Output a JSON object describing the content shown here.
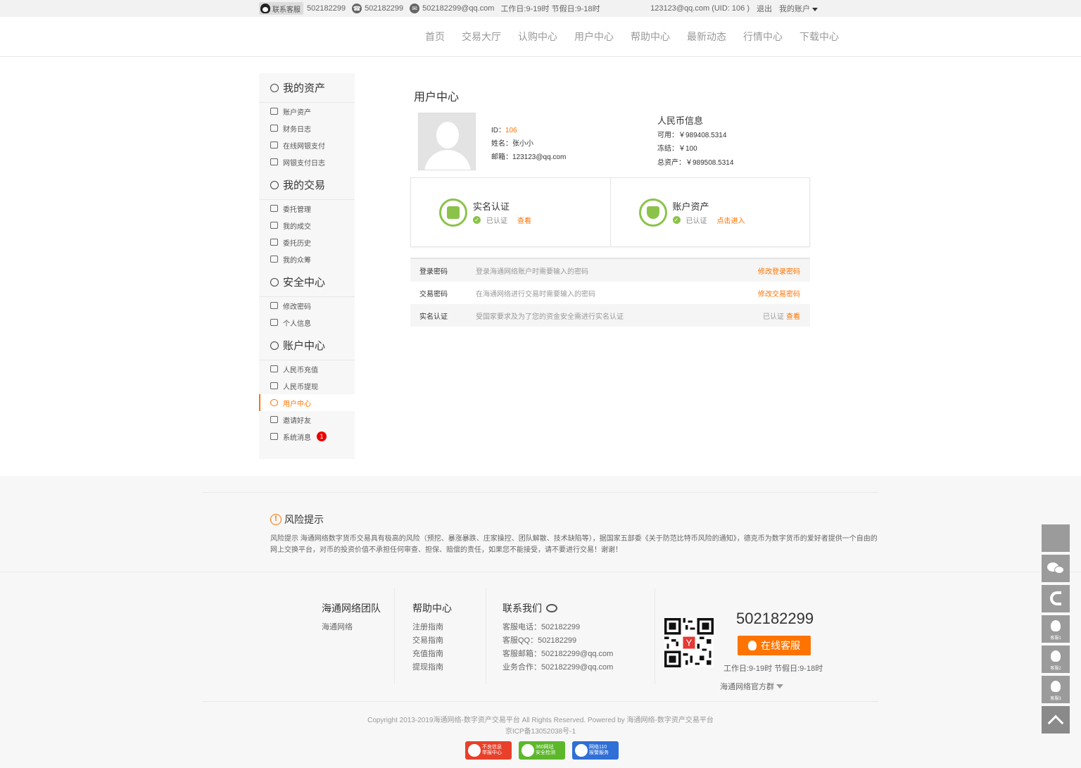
{
  "topbar": {
    "kefu_label": "联系客服",
    "qq": "502182299",
    "phone": "502182299",
    "email": "502182299@qq.com",
    "hours": "工作日:9-19时 节假日:9-18时",
    "user_email": "123123@qq.com",
    "uid": "(UID: 106 )",
    "logout": "退出",
    "my_account": "我的账户"
  },
  "nav": [
    "首页",
    "交易大厅",
    "认购中心",
    "用户中心",
    "帮助中心",
    "最新动态",
    "行情中心",
    "下载中心"
  ],
  "sidebar": {
    "groups": [
      {
        "title": "我的资产",
        "items": [
          "账户资产",
          "财务日志",
          "在线网银支付",
          "网银支付日志"
        ]
      },
      {
        "title": "我的交易",
        "items": [
          "委托管理",
          "我的成交",
          "委托历史",
          "我的众筹"
        ]
      },
      {
        "title": "安全中心",
        "items": [
          "修改密码",
          "个人信息"
        ]
      },
      {
        "title": "账户中心",
        "items": [
          "人民币充值",
          "人民币提现",
          "用户中心",
          "邀请好友",
          "系统消息"
        ]
      }
    ],
    "active": "用户中心",
    "message_badge": "1"
  },
  "main": {
    "title": "用户中心",
    "user": {
      "id_label": "ID：",
      "id": "106",
      "name_label": "姓名：",
      "name": "张小小",
      "email_label": "邮箱：",
      "email": "123123@qq.com"
    },
    "rmb": {
      "title": "人民币信息",
      "available": "可用：￥989408.5314",
      "frozen": "冻结：￥100",
      "total": "总资产：￥989508.5314"
    },
    "cards": [
      {
        "title": "实名认证",
        "status": "已认证",
        "link": "查看"
      },
      {
        "title": "账户资产",
        "status": "已认证",
        "link": "点击进入"
      }
    ],
    "security": [
      {
        "key": "登录密码",
        "desc": "登录海通网络账户时需要输入的密码",
        "status": "",
        "action": "修改登录密码"
      },
      {
        "key": "交易密码",
        "desc": "在海通网络进行交易时需要输入的密码",
        "status": "",
        "action": "修改交易密码"
      },
      {
        "key": "实名认证",
        "desc": "受国家要求及为了您的资金安全需进行实名认证",
        "status": "已认证",
        "action": "查看"
      }
    ]
  },
  "footer": {
    "risk_title": "风险提示",
    "risk_text": "风险提示 海通网络数字货币交易具有极高的风险（预挖、暴涨暴跌、庄家操控、团队解散、技术缺陷等），据国家五部委《关于防范比特币风险的通知》，德克币为数字货币的爱好者提供一个自由的网上交换平台，对币的投资价值不承担任何审查、担保、赔偿的责任，如果您不能接受，请不要进行交易！谢谢！",
    "col1": {
      "title": "海通网络团队",
      "items": [
        "海通网络"
      ]
    },
    "col2": {
      "title": "帮助中心",
      "items": [
        "注册指南",
        "交易指南",
        "充值指南",
        "提现指南"
      ]
    },
    "col3": {
      "title": "联系我们",
      "items": [
        "客服电话：502182299",
        "客服QQ：502182299",
        "客服邮箱：502182299@qq.com",
        "业务合作：502182299@qq.com"
      ]
    },
    "phone_big": "502182299",
    "online_kf": "在线客服",
    "worktime": "工作日:9-19时 节假日:9-18时",
    "group": "海通网络官方群",
    "copyright": "Copyright 2013-2019海通网络-数字资产交易平台 All Rights Reserved. Powered by 海通网络-数字资产交易平台",
    "icp": "京ICP备13052038号-1",
    "badges": [
      {
        "line1": "不良信息",
        "line2": "举报中心"
      },
      {
        "line1": "360网站",
        "line2": "安全检测"
      },
      {
        "line1": "网络110",
        "line2": "报警服务"
      }
    ]
  },
  "floatbar": {
    "kf1": "客服1",
    "kf2": "客服2",
    "kf3": "客服3"
  },
  "colors": {
    "accent": "#ff7300",
    "green": "#8bc34a"
  }
}
